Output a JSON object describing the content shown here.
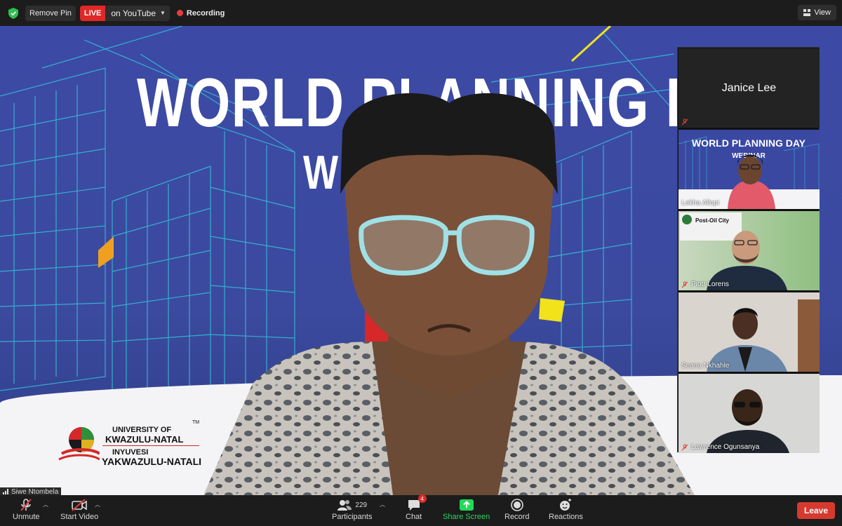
{
  "topbar": {
    "remove_pin": "Remove Pin",
    "live_badge": "LIVE",
    "live_target": "on YouTube",
    "recording": "Recording",
    "view": "View"
  },
  "banner": {
    "title": "WORLD PLANNING DA",
    "subtitle": "W      R"
  },
  "logo": {
    "line1": "UNIVERSITY OF",
    "line2": "KWAZULU-NATAL",
    "line3": "INYUVESI",
    "line4": "YAKWAZULU-NATALI",
    "tm": "TM"
  },
  "main_speaker_tag": "Siwe Ntombela",
  "participants": [
    {
      "name": "Janice Lee",
      "muted": true
    },
    {
      "name": "Lekha Allopi",
      "muted": false
    },
    {
      "name": "Piotr Lorens",
      "muted": true
    },
    {
      "name": "Seana Nkhahle",
      "muted": false
    },
    {
      "name": "Lawrence Ogunsanya",
      "muted": true
    }
  ],
  "thumb_banner": {
    "title": "WORLD PLANNING DAY",
    "subtitle": "WEBINAR",
    "post_oil": "Post-Oil City"
  },
  "toolbar": {
    "unmute": "Unmute",
    "start_video": "Start Video",
    "participants": "Participants",
    "participant_count": "229",
    "chat": "Chat",
    "chat_badge": "4",
    "share_screen": "Share Screen",
    "record": "Record",
    "reactions": "Reactions",
    "leave": "Leave"
  },
  "colors": {
    "live_red": "#e02828",
    "share_green": "#23d959",
    "leave_red": "#d63a2f",
    "banner_blue": "#3c4aa6"
  }
}
